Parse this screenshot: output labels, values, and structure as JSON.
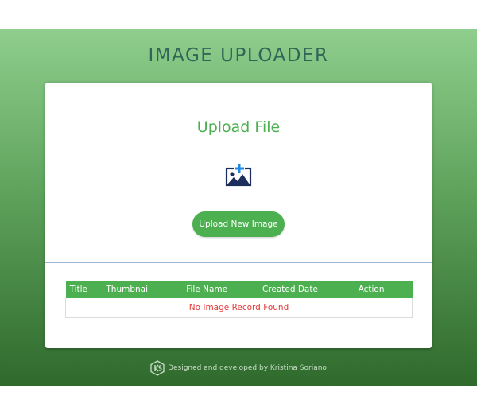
{
  "header": {
    "title": "IMAGE UPLOADER"
  },
  "upload": {
    "heading": "Upload File",
    "icon": "add-image-icon",
    "button_label": "Upload New Image"
  },
  "table": {
    "columns": [
      "Title",
      "Thumbnail",
      "File Name",
      "Created Date",
      "Action"
    ],
    "empty_message": "No Image Record Found"
  },
  "footer": {
    "logo_icon": "ks-logo-icon",
    "credit": "Designed and developed by Kristina Soriano"
  },
  "colors": {
    "accent": "#4caf50",
    "title": "#2f6657",
    "error": "#e53935",
    "icon_blue": "#1e88e5",
    "icon_navy": "#1c2f5c"
  }
}
